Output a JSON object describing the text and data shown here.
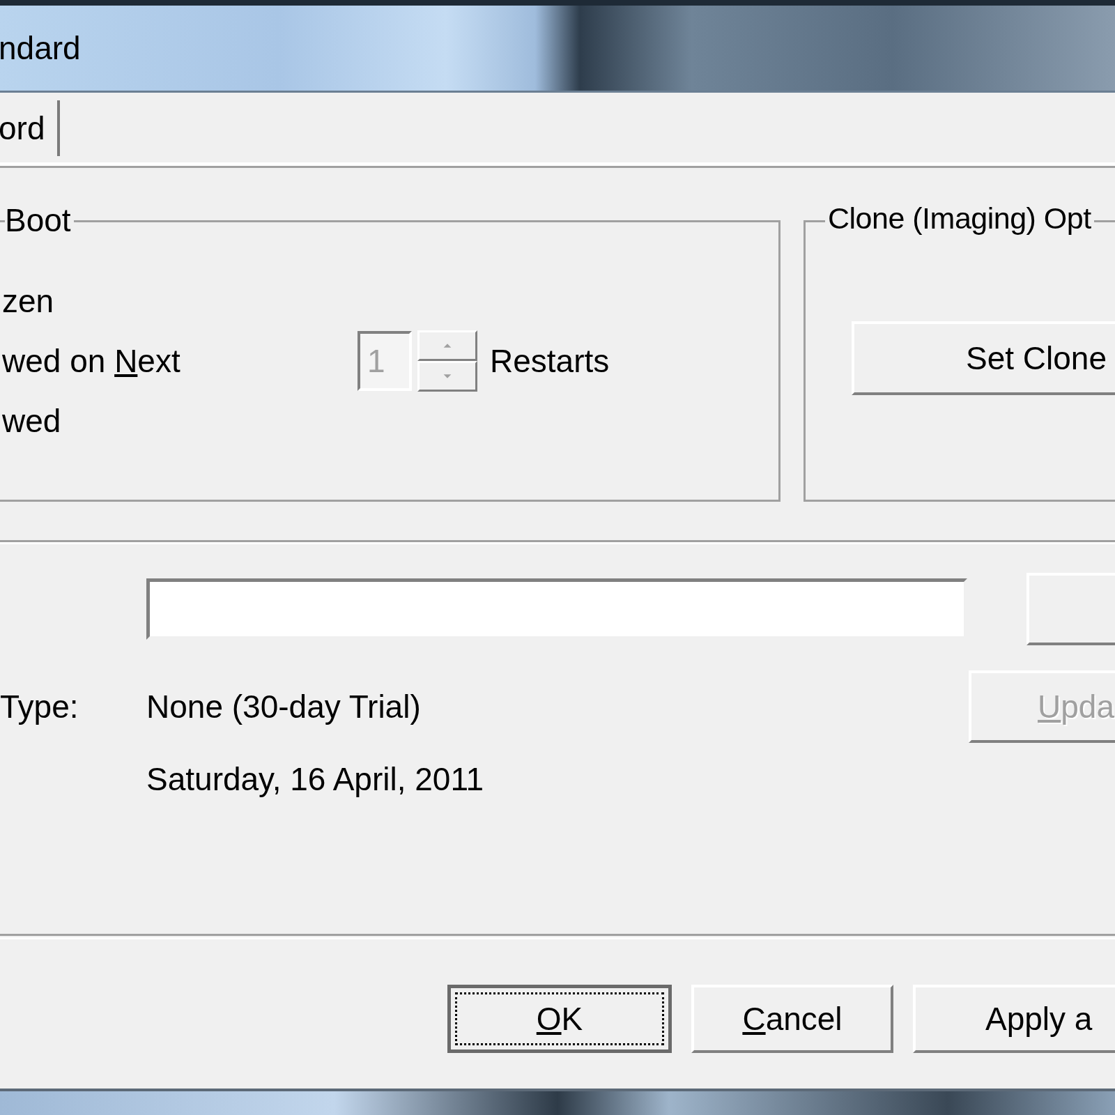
{
  "window": {
    "title": "ndard"
  },
  "tabs": [
    {
      "label": "ord",
      "selected": false
    }
  ],
  "boot_group": {
    "label": "Boot",
    "options": [
      {
        "before": "zen"
      },
      {
        "before": "wed on ",
        "key": "N",
        "after": "ext"
      },
      {
        "before": "wed"
      }
    ],
    "spin": {
      "value": "1",
      "disabled": true
    },
    "spin_unit": "Restarts"
  },
  "clone_group": {
    "label": "Clone (Imaging) Opt",
    "button": {
      "before": "Set Clone"
    }
  },
  "license": {
    "type_label": "Type:",
    "type_value": "None (30-day Trial)",
    "date": "Saturday, 16 April, 2011",
    "update_button": {
      "key": "U",
      "after": "pda",
      "disabled": true
    }
  },
  "buttons": [
    {
      "key": "O",
      "after": "K",
      "default": true
    },
    {
      "key": "C",
      "after": "ancel",
      "default": false
    },
    {
      "before": "Apply a",
      "default": false
    }
  ]
}
